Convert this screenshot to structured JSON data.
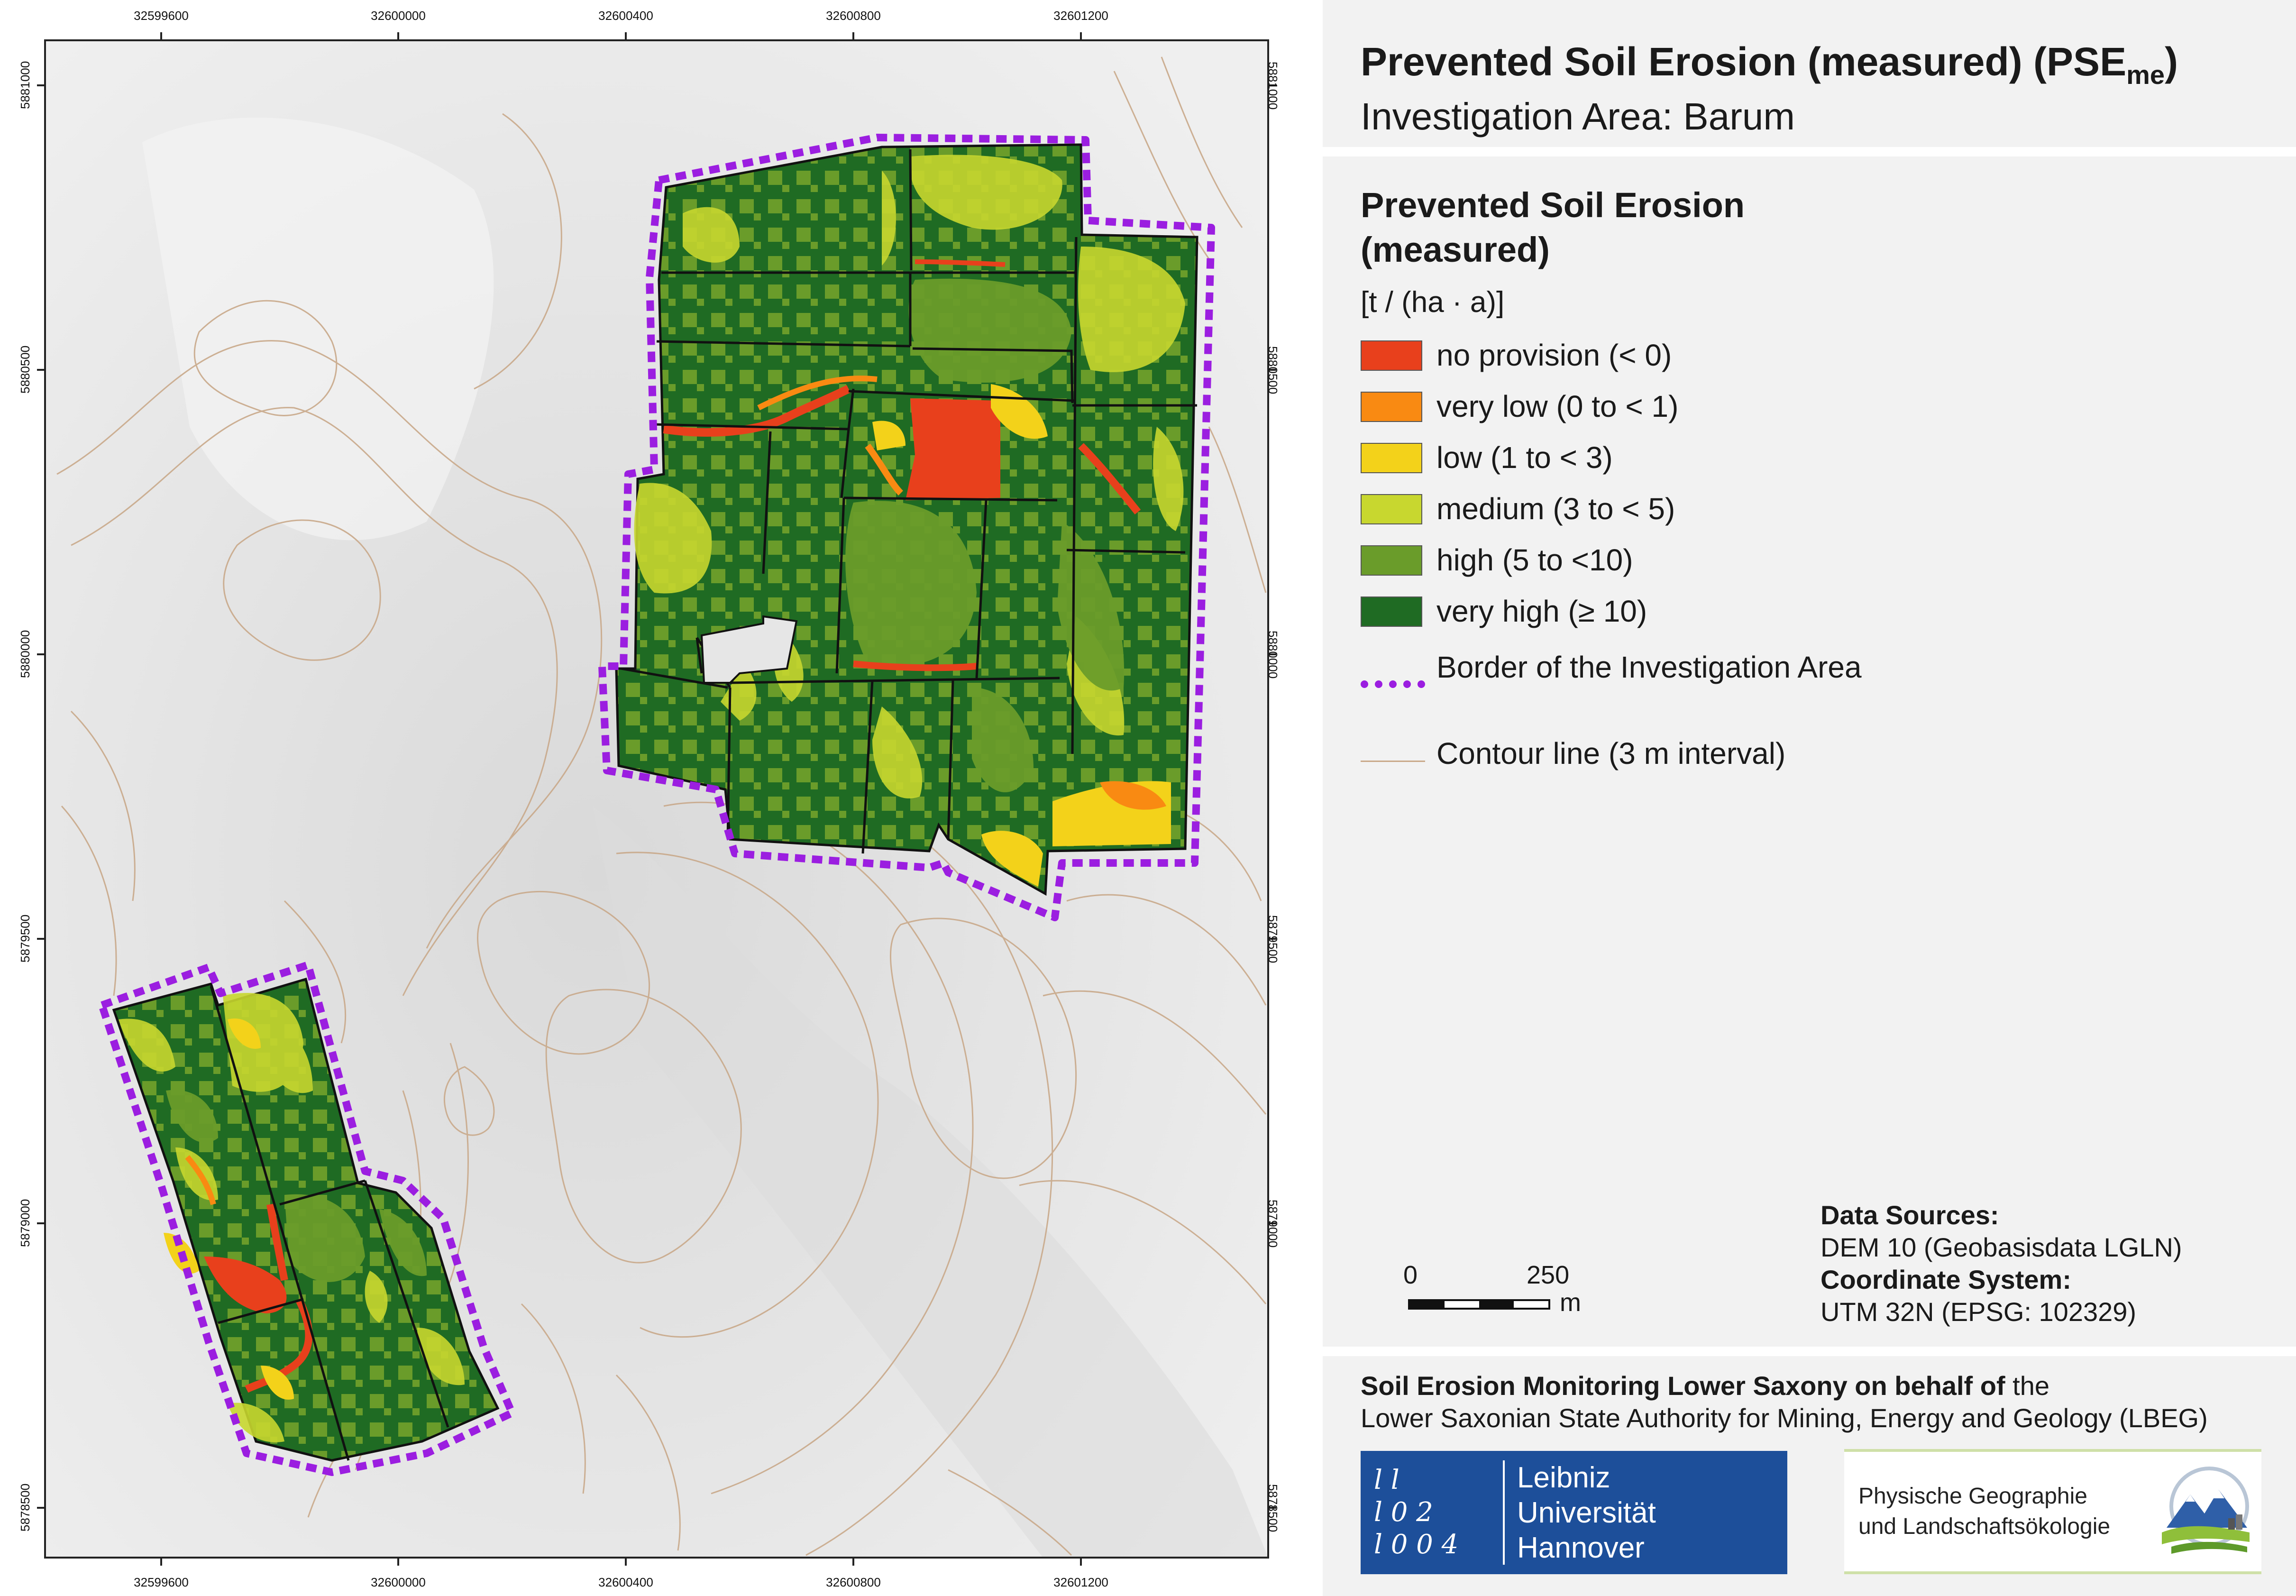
{
  "map": {
    "x_ticks": [
      "32599600",
      "32600000",
      "32600400",
      "32600800",
      "32601200"
    ],
    "y_ticks": [
      "5881000",
      "5880500",
      "5880000",
      "5879500",
      "5879000",
      "5878500"
    ],
    "colors": {
      "no_provision": "#e8401c",
      "very_low": "#f98a12",
      "low": "#f3d21a",
      "medium": "#c8d72f",
      "high": "#6a9c2a",
      "very_high": "#1f6b23",
      "border": "#9b1ee0",
      "contour": "#c9a98a",
      "hillshade": "#e6e6e6"
    }
  },
  "title": {
    "main": "Prevented Soil Erosion (measured) (PSE",
    "main_sub": "me",
    "main_close": ")",
    "subtitle": "Investigation Area: Barum"
  },
  "legend": {
    "heading": "Prevented Soil Erosion (measured)",
    "unit": "[t / (ha · a)]",
    "classes": [
      {
        "label": "no provision (< 0)",
        "color": "#e8401c"
      },
      {
        "label": "very low (0  to < 1)",
        "color": "#f98a12"
      },
      {
        "label": "low (1 to < 3)",
        "color": "#f3d21a"
      },
      {
        "label": "medium (3 to < 5)",
        "color": "#c8d72f"
      },
      {
        "label": "high (5 to <10)",
        "color": "#6a9c2a"
      },
      {
        "label": "very high (≥ 10)",
        "color": "#1f6b23"
      }
    ],
    "border_label": "Border of the Investigation Area",
    "contour_label": "Contour line (3 m interval)"
  },
  "scale": {
    "zero": "0",
    "mark": "250",
    "unit": "m"
  },
  "sources": {
    "data_heading": "Data Sources:",
    "data_value": "DEM 10 (Geobasisdata LGLN)",
    "crs_heading": "Coordinate System:",
    "crs_value": "UTM 32N (EPSG: 102329)"
  },
  "credit": {
    "line1_bold": "Soil Erosion Monitoring Lower Saxony on behalf of",
    "line1_rest": " the",
    "line2": "Lower Saxonian State Authority for Mining, Energy and Geology (LBEG)"
  },
  "logos": {
    "luh_mark": [
      "l  l",
      "l 0 2",
      "l 0 0 4"
    ],
    "luh_text": [
      "Leibniz",
      "Universität",
      "Hannover"
    ],
    "pg_text": [
      "Physische Geographie",
      "und Landschaftsökologie"
    ]
  }
}
